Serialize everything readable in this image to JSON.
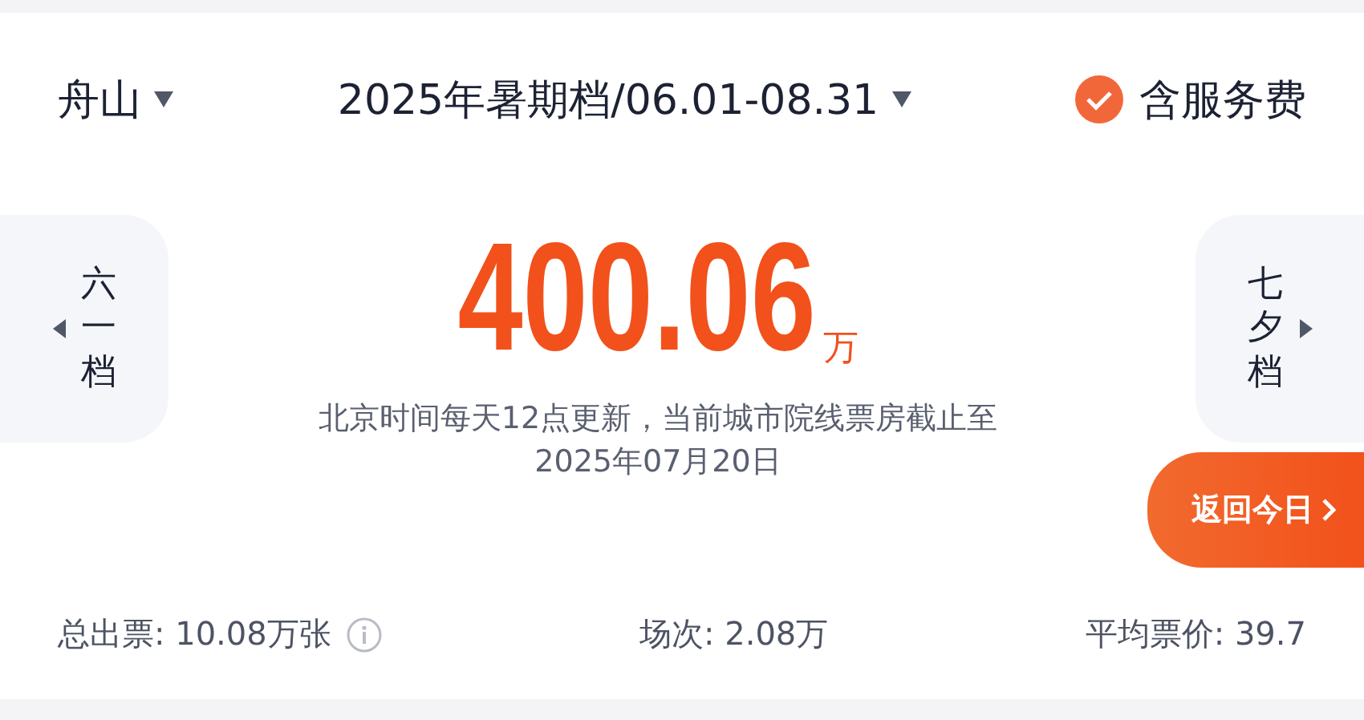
{
  "header": {
    "city": "舟山",
    "period": "2025年暑期档/06.01-08.31",
    "service_fee": {
      "label": "含服务费",
      "checked": true
    }
  },
  "prev_period": {
    "label": "六一档"
  },
  "next_period": {
    "label": "七夕档"
  },
  "box_office": {
    "value": "400.06",
    "unit": "万"
  },
  "note": [
    "北京时间每天12点更新，当前城市院线票房截止至",
    "2025年07月20日"
  ],
  "return_button": {
    "label": "返回今日"
  },
  "stats": [
    {
      "text": "总出票: 10.08万张",
      "info": true
    },
    {
      "text": "场次: 2.08万",
      "info": false
    },
    {
      "text": "平均票价: 39.7",
      "info": false
    }
  ]
}
